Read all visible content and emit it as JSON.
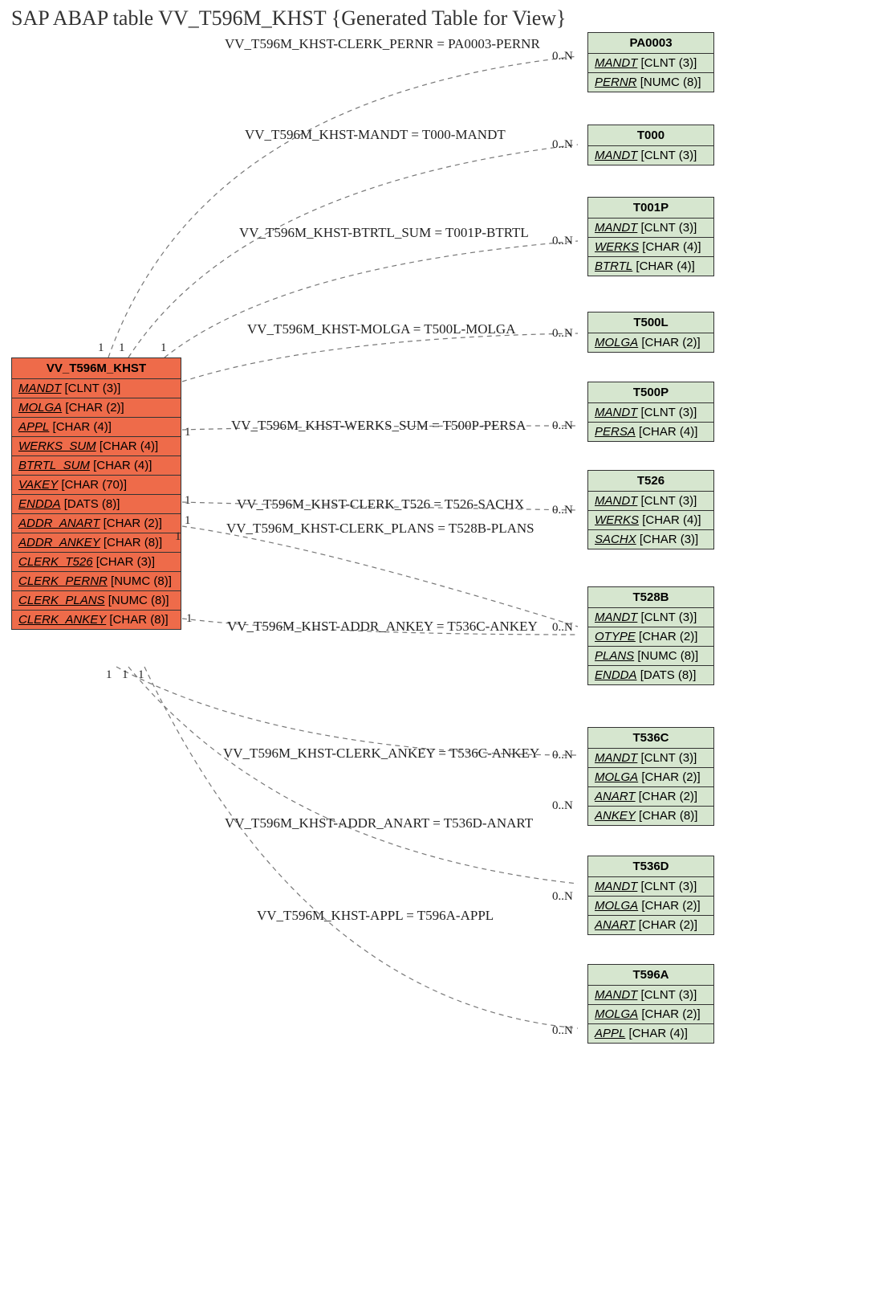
{
  "title": "SAP ABAP table VV_T596M_KHST {Generated Table for View}",
  "main_entity": {
    "name": "VV_T596M_KHST",
    "fields": [
      {
        "name": "MANDT",
        "type": "[CLNT (3)]"
      },
      {
        "name": "MOLGA",
        "type": "[CHAR (2)]"
      },
      {
        "name": "APPL",
        "type": "[CHAR (4)]"
      },
      {
        "name": "WERKS_SUM",
        "type": "[CHAR (4)]"
      },
      {
        "name": "BTRTL_SUM",
        "type": "[CHAR (4)]"
      },
      {
        "name": "VAKEY",
        "type": "[CHAR (70)]"
      },
      {
        "name": "ENDDA",
        "type": "[DATS (8)]"
      },
      {
        "name": "ADDR_ANART",
        "type": "[CHAR (2)]"
      },
      {
        "name": "ADDR_ANKEY",
        "type": "[CHAR (8)]"
      },
      {
        "name": "CLERK_T526",
        "type": "[CHAR (3)]"
      },
      {
        "name": "CLERK_PERNR",
        "type": "[NUMC (8)]"
      },
      {
        "name": "CLERK_PLANS",
        "type": "[NUMC (8)]"
      },
      {
        "name": "CLERK_ANKEY",
        "type": "[CHAR (8)]"
      }
    ]
  },
  "related": [
    {
      "name": "PA0003",
      "fields": [
        {
          "name": "MANDT",
          "type": "[CLNT (3)]"
        },
        {
          "name": "PERNR",
          "type": "[NUMC (8)]"
        }
      ]
    },
    {
      "name": "T000",
      "fields": [
        {
          "name": "MANDT",
          "type": "[CLNT (3)]"
        }
      ]
    },
    {
      "name": "T001P",
      "fields": [
        {
          "name": "MANDT",
          "type": "[CLNT (3)]"
        },
        {
          "name": "WERKS",
          "type": "[CHAR (4)]"
        },
        {
          "name": "BTRTL",
          "type": "[CHAR (4)]"
        }
      ]
    },
    {
      "name": "T500L",
      "fields": [
        {
          "name": "MOLGA",
          "type": "[CHAR (2)]"
        }
      ]
    },
    {
      "name": "T500P",
      "fields": [
        {
          "name": "MANDT",
          "type": "[CLNT (3)]"
        },
        {
          "name": "PERSA",
          "type": "[CHAR (4)]"
        }
      ]
    },
    {
      "name": "T526",
      "fields": [
        {
          "name": "MANDT",
          "type": "[CLNT (3)]"
        },
        {
          "name": "WERKS",
          "type": "[CHAR (4)]"
        },
        {
          "name": "SACHX",
          "type": "[CHAR (3)]"
        }
      ]
    },
    {
      "name": "T528B",
      "fields": [
        {
          "name": "MANDT",
          "type": "[CLNT (3)]"
        },
        {
          "name": "OTYPE",
          "type": "[CHAR (2)]"
        },
        {
          "name": "PLANS",
          "type": "[NUMC (8)]"
        },
        {
          "name": "ENDDA",
          "type": "[DATS (8)]"
        }
      ]
    },
    {
      "name": "T536C",
      "fields": [
        {
          "name": "MANDT",
          "type": "[CLNT (3)]"
        },
        {
          "name": "MOLGA",
          "type": "[CHAR (2)]"
        },
        {
          "name": "ANART",
          "type": "[CHAR (2)]"
        },
        {
          "name": "ANKEY",
          "type": "[CHAR (8)]"
        }
      ]
    },
    {
      "name": "T536D",
      "fields": [
        {
          "name": "MANDT",
          "type": "[CLNT (3)]"
        },
        {
          "name": "MOLGA",
          "type": "[CHAR (2)]"
        },
        {
          "name": "ANART",
          "type": "[CHAR (2)]"
        }
      ]
    },
    {
      "name": "T596A",
      "fields": [
        {
          "name": "MANDT",
          "type": "[CLNT (3)]"
        },
        {
          "name": "MOLGA",
          "type": "[CHAR (2)]"
        },
        {
          "name": "APPL",
          "type": "[CHAR (4)]"
        }
      ]
    }
  ],
  "relations": [
    {
      "label": "VV_T596M_KHST-CLERK_PERNR = PA0003-PERNR",
      "card_left": "1",
      "card_right": "0..N"
    },
    {
      "label": "VV_T596M_KHST-MANDT = T000-MANDT",
      "card_left": "1",
      "card_right": "0..N"
    },
    {
      "label": "VV_T596M_KHST-BTRTL_SUM = T001P-BTRTL",
      "card_left": "1",
      "card_right": "0..N"
    },
    {
      "label": "VV_T596M_KHST-MOLGA = T500L-MOLGA",
      "card_left": "",
      "card_right": "0..N"
    },
    {
      "label": "VV_T596M_KHST-WERKS_SUM = T500P-PERSA",
      "card_left": "1",
      "card_right": "0..N"
    },
    {
      "label": "VV_T596M_KHST-CLERK_T526 = T526-SACHX",
      "card_left": "1",
      "card_right": "0..N"
    },
    {
      "label": "VV_T596M_KHST-CLERK_PLANS = T528B-PLANS",
      "card_left": "1",
      "card_right": ""
    },
    {
      "label": "VV_T596M_KHST-ADDR_ANKEY = T536C-ANKEY",
      "card_left": "1",
      "card_right": "0..N"
    },
    {
      "label": "VV_T596M_KHST-CLERK_ANKEY = T536C-ANKEY",
      "card_left": "1",
      "card_right": "0..N"
    },
    {
      "label": "VV_T596M_KHST-ADDR_ANART = T536D-ANART",
      "card_left": "1",
      "card_right": "0..N"
    },
    {
      "label": "VV_T596M_KHST-APPL = T596A-APPL",
      "card_left": "1",
      "card_right": "0..N"
    }
  ],
  "chart_data": {
    "type": "erd",
    "main": "VV_T596M_KHST",
    "relations": [
      {
        "from": "VV_T596M_KHST.CLERK_PERNR",
        "to": "PA0003.PERNR",
        "card": "1 : 0..N"
      },
      {
        "from": "VV_T596M_KHST.MANDT",
        "to": "T000.MANDT",
        "card": "1 : 0..N"
      },
      {
        "from": "VV_T596M_KHST.BTRTL_SUM",
        "to": "T001P.BTRTL",
        "card": "1 : 0..N"
      },
      {
        "from": "VV_T596M_KHST.MOLGA",
        "to": "T500L.MOLGA",
        "card": "1 : 0..N"
      },
      {
        "from": "VV_T596M_KHST.WERKS_SUM",
        "to": "T500P.PERSA",
        "card": "1 : 0..N"
      },
      {
        "from": "VV_T596M_KHST.CLERK_T526",
        "to": "T526.SACHX",
        "card": "1 : 0..N"
      },
      {
        "from": "VV_T596M_KHST.CLERK_PLANS",
        "to": "T528B.PLANS",
        "card": "1 : 0..N"
      },
      {
        "from": "VV_T596M_KHST.ADDR_ANKEY",
        "to": "T536C.ANKEY",
        "card": "1 : 0..N"
      },
      {
        "from": "VV_T596M_KHST.CLERK_ANKEY",
        "to": "T536C.ANKEY",
        "card": "1 : 0..N"
      },
      {
        "from": "VV_T596M_KHST.ADDR_ANART",
        "to": "T536D.ANART",
        "card": "1 : 0..N"
      },
      {
        "from": "VV_T596M_KHST.APPL",
        "to": "T596A.APPL",
        "card": "1 : 0..N"
      }
    ]
  }
}
